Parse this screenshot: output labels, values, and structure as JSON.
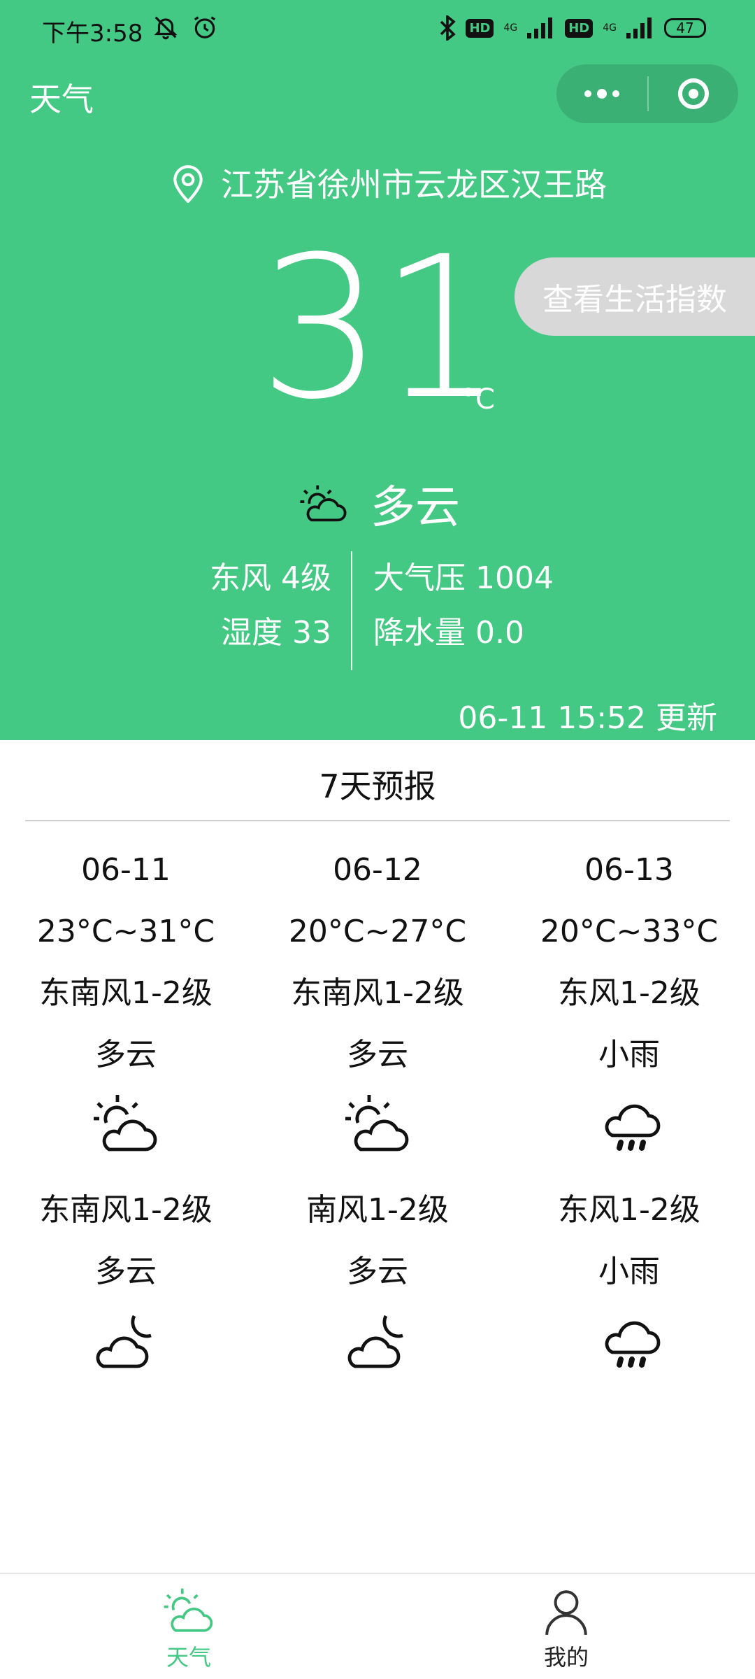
{
  "status_bar": {
    "time": "下午3:58",
    "network_1": "4G",
    "network_2": "4G",
    "hd_label": "HD",
    "battery": "47"
  },
  "nav": {
    "title": "天气",
    "more_icon": "more-dots-icon",
    "close_icon": "target-circle-icon"
  },
  "location": {
    "icon": "location-pin-icon",
    "address": "江苏省徐州市云龙区汉王路"
  },
  "life_index_button": "查看生活指数",
  "current": {
    "temperature": "31",
    "unit": "°C",
    "condition_icon": "partly-cloudy-icon",
    "condition": "多云",
    "wind": "东风 4级",
    "humidity": "湿度 33",
    "pressure": "大气压 1004",
    "precipitation": "降水量 0.0",
    "updated": "06-11 15:52 更新"
  },
  "forecast": {
    "title": "7天预报",
    "days": [
      {
        "date": "06-11",
        "temp_range": "23°C~31°C",
        "day_wind": "东南风1-2级",
        "day_condition": "多云",
        "day_icon": "partly-cloudy-icon",
        "night_wind": "东南风1-2级",
        "night_condition": "多云",
        "night_icon": "cloudy-night-icon"
      },
      {
        "date": "06-12",
        "temp_range": "20°C~27°C",
        "day_wind": "东南风1-2级",
        "day_condition": "多云",
        "day_icon": "partly-cloudy-icon",
        "night_wind": "南风1-2级",
        "night_condition": "多云",
        "night_icon": "cloudy-night-icon"
      },
      {
        "date": "06-13",
        "temp_range": "20°C~33°C",
        "day_wind": "东风1-2级",
        "day_condition": "小雨",
        "day_icon": "light-rain-icon",
        "night_wind": "东风1-2级",
        "night_condition": "小雨",
        "night_icon": "light-rain-icon"
      }
    ]
  },
  "tabbar": {
    "weather": "天气",
    "mine": "我的"
  },
  "colors": {
    "primary": "#43c984",
    "life_button": "#d8d8d8"
  }
}
